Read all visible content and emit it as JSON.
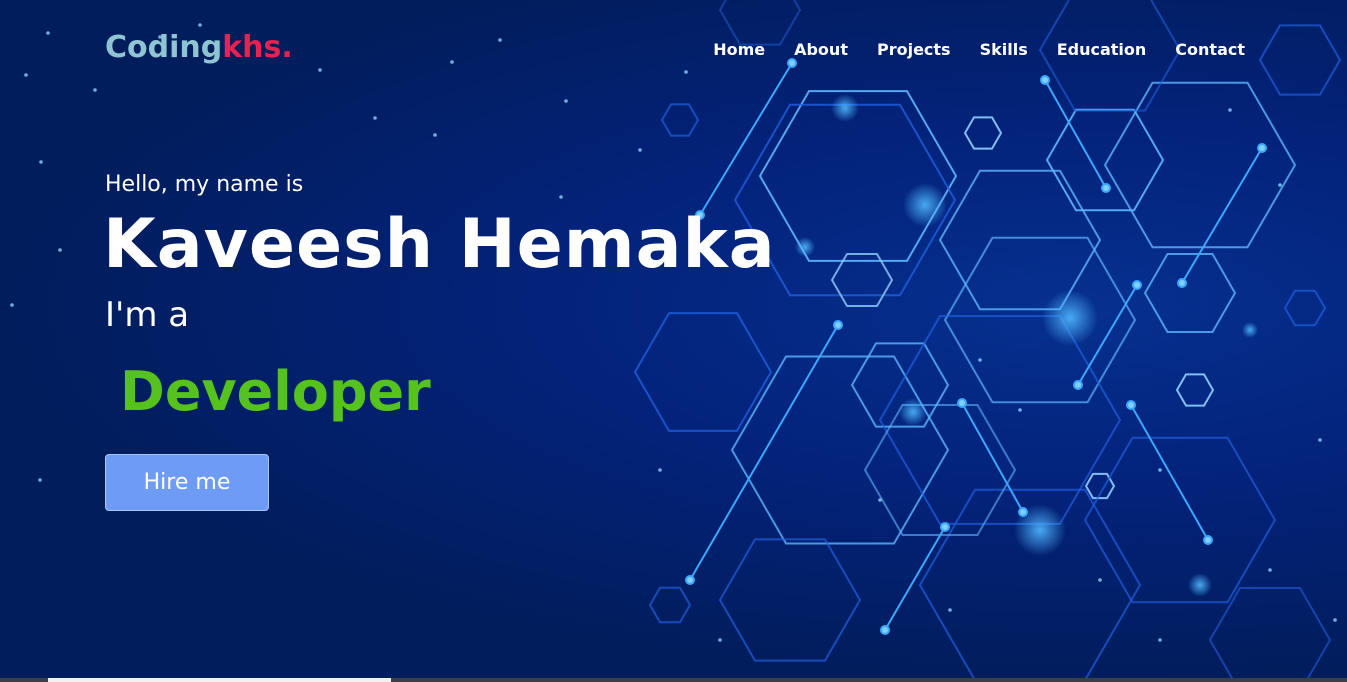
{
  "logo": {
    "part1": "Coding",
    "part2": "khs."
  },
  "nav": {
    "items": [
      "Home",
      "About",
      "Projects",
      "Skills",
      "Education",
      "Contact"
    ]
  },
  "hero": {
    "greeting": "Hello, my name is",
    "name": "Kaveesh Hemaka",
    "role_prefix": "I'm a",
    "role": "Developer",
    "cta_label": "Hire me"
  },
  "colors": {
    "background": "#021d5c",
    "logo_primary": "#8fc4d3",
    "logo_accent": "#e8214f",
    "role": "#56c21d",
    "button": "#6d9bf6"
  }
}
